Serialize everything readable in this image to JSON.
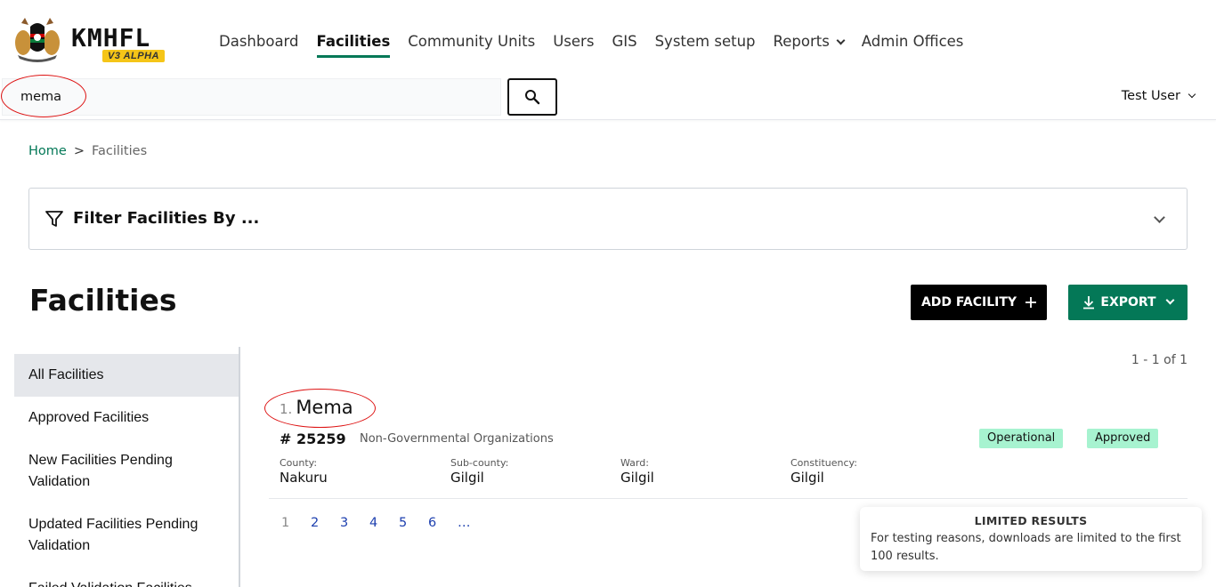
{
  "header": {
    "brand": "KMHFL",
    "badge": "V3 ALPHA",
    "nav": [
      {
        "label": "Dashboard"
      },
      {
        "label": "Facilities",
        "active": true
      },
      {
        "label": "Community Units"
      },
      {
        "label": "Users"
      },
      {
        "label": "GIS"
      },
      {
        "label": "System setup"
      },
      {
        "label": "Reports",
        "dropdown": true
      },
      {
        "label": "Admin Offices"
      }
    ],
    "search": {
      "value": "mema"
    },
    "user": "Test User"
  },
  "breadcrumb": {
    "home": "Home",
    "separator": ">",
    "current": "Facilities"
  },
  "filter": {
    "title": "Filter Facilities By ..."
  },
  "page": {
    "title": "Facilities",
    "add_label": "ADD FACILITY",
    "export_label": "EXPORT"
  },
  "sidebar": {
    "items": [
      {
        "label": "All Facilities",
        "active": true
      },
      {
        "label": "Approved Facilities"
      },
      {
        "label": "New Facilities Pending Validation"
      },
      {
        "label": "Updated Facilities Pending Validation"
      },
      {
        "label": "Failed Validation Facilities"
      }
    ]
  },
  "results": {
    "count": "1 - 1 of 1",
    "items": [
      {
        "index": "1.",
        "name": "Mema",
        "code": "# 25259",
        "owner": "Non-Governmental Organizations",
        "status": "Operational",
        "approval": "Approved",
        "county_label": "County:",
        "county": "Nakuru",
        "subcounty_label": "Sub-county:",
        "subcounty": "Gilgil",
        "ward_label": "Ward:",
        "ward": "Gilgil",
        "constituency_label": "Constituency:",
        "constituency": "Gilgil"
      }
    ]
  },
  "pagination": {
    "pages": [
      "1",
      "2",
      "3",
      "4",
      "5",
      "6",
      "…"
    ],
    "current": "1"
  },
  "toast": {
    "title": "LIMITED RESULTS",
    "body": "For testing reasons, downloads are limited to the first 100 results."
  },
  "colors": {
    "primary": "#047857",
    "badge": "#a7f3d0",
    "accent": "#f5c518",
    "annotation": "#dd1111"
  }
}
